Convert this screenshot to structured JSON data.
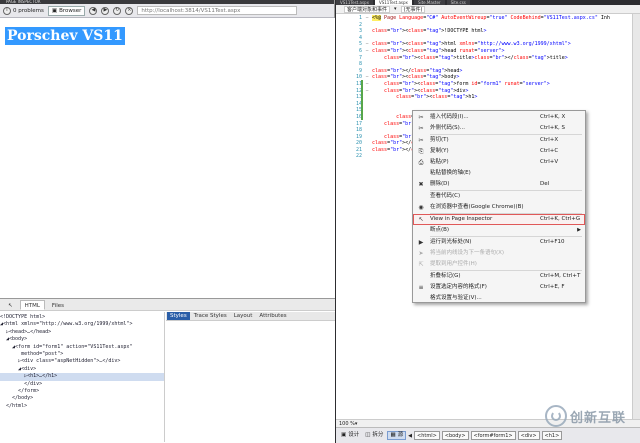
{
  "inspector": {
    "title": "PAGE INSPECTOR",
    "problems": "0 problems",
    "browser_label": "Browser",
    "url": "http://localhost:3814/VS11Test.aspx",
    "heading": "Porschev VS11",
    "dom_tabs": [
      "HTML",
      "Files"
    ],
    "tree_lines": [
      "<!DOCTYPE html>",
      "◢<html xmlns=\"http://www.w3.org/1999/xhtml\">",
      "  ▷<head>…</head>",
      "  ◢<body>",
      "    ◢<form id=\"form1\" action=\"VS11Test.aspx\"",
      "       method=\"post\">",
      "      ▷<div class=\"aspNetHidden\">…</div>",
      "      ◢<div>",
      "        ▷<h1>…</h1>",
      "        </div>",
      "      </form>",
      "    </body>",
      "  </html>"
    ],
    "selected_tree_line": 8,
    "style_tabs": [
      "Styles",
      "Trace Styles",
      "Layout",
      "Attributes"
    ]
  },
  "editor": {
    "doc_tabs": [
      "VS11Test.aspx",
      "VS11Test.aspx",
      "Site.Master",
      "Site.css"
    ],
    "nav_left": "客户端对象和事件",
    "nav_right": "(无事件)",
    "line_numbers": [
      "1",
      "2",
      "3",
      "4",
      "5",
      "6",
      "7",
      "8",
      "9",
      "10",
      "11",
      "12",
      "13",
      "14",
      "15",
      "16",
      "17",
      "18",
      "19",
      "20",
      "21",
      "22"
    ],
    "code_lines": [
      "<%@ Page Language=\"C#\" AutoEventWireup=\"true\" CodeBehind=\"VS11Test.aspx.cs\" Inh",
      "",
      "<!DOCTYPE html>",
      "",
      "<html xmlns=\"http://www.w3.org/1999/xhtml\">",
      "<head runat=\"server\">",
      "    <title></title>",
      "",
      "</head>",
      "<body>",
      "    <form id=\"form1\" runat=\"server\">",
      "    <div>",
      "        <h1>",
      "",
      "",
      "        </h1>",
      "    </div>",
      "",
      "    </form>",
      "</body>",
      "</html>",
      ""
    ],
    "zoom": "100 %",
    "view_buttons": [
      "设计",
      "拆分",
      "源"
    ],
    "breadcrumbs": [
      "<html>",
      "<body>",
      "<form#form1>",
      "<div>",
      "<h1>"
    ]
  },
  "context_menu": {
    "items": [
      {
        "icon": "snippet",
        "label": "插入代码段(I)...",
        "shortcut": "Ctrl+K, X",
        "disabled": false
      },
      {
        "icon": "surround",
        "label": "外侧代码(S)...",
        "shortcut": "Ctrl+K, S",
        "disabled": false
      },
      {
        "sep": true
      },
      {
        "icon": "cut",
        "label": "剪切(T)",
        "shortcut": "Ctrl+X",
        "disabled": false
      },
      {
        "icon": "copy",
        "label": "复制(Y)",
        "shortcut": "Ctrl+C",
        "disabled": false
      },
      {
        "icon": "paste",
        "label": "粘贴(P)",
        "shortcut": "Ctrl+V",
        "disabled": false
      },
      {
        "icon": "",
        "label": "粘贴替换的轴(E)",
        "shortcut": "",
        "disabled": false
      },
      {
        "icon": "delete",
        "label": "删除(D)",
        "shortcut": "Del",
        "disabled": false
      },
      {
        "sep": true
      },
      {
        "icon": "",
        "label": "查看代码(C)",
        "shortcut": "",
        "disabled": false
      },
      {
        "icon": "browser",
        "label": "在浏览器中查看(Google Chrome)(B)",
        "shortcut": "",
        "disabled": false
      },
      {
        "sep": true
      },
      {
        "icon": "inspect",
        "label": "View in Page Inspector",
        "shortcut": "Ctrl+K, Ctrl+G",
        "disabled": false,
        "highlight": true
      },
      {
        "icon": "",
        "label": "断点(B)",
        "shortcut": "",
        "disabled": false,
        "submenu": true
      },
      {
        "sep": true
      },
      {
        "icon": "run",
        "label": "运行到光标处(N)",
        "shortcut": "Ctrl+F10",
        "disabled": false
      },
      {
        "icon": "set",
        "label": "将当前内线设为下一条语句(X)",
        "shortcut": "",
        "disabled": true
      },
      {
        "icon": "extract",
        "label": "提取到用户控件(H)",
        "shortcut": "",
        "disabled": true
      },
      {
        "sep": true
      },
      {
        "icon": "",
        "label": "折叠标记(G)",
        "shortcut": "Ctrl+M, Ctrl+T",
        "disabled": false
      },
      {
        "icon": "format",
        "label": "设置选定内容的格式(F)",
        "shortcut": "Ctrl+E, F",
        "disabled": false
      },
      {
        "icon": "",
        "label": "格式设置与验证(V)...",
        "shortcut": "",
        "disabled": false
      }
    ]
  },
  "watermark": {
    "text": "创新互联"
  },
  "colors": {
    "selection": "#3399ff",
    "accent": "#2a5ea8",
    "highlight_outline": "#e05858"
  }
}
